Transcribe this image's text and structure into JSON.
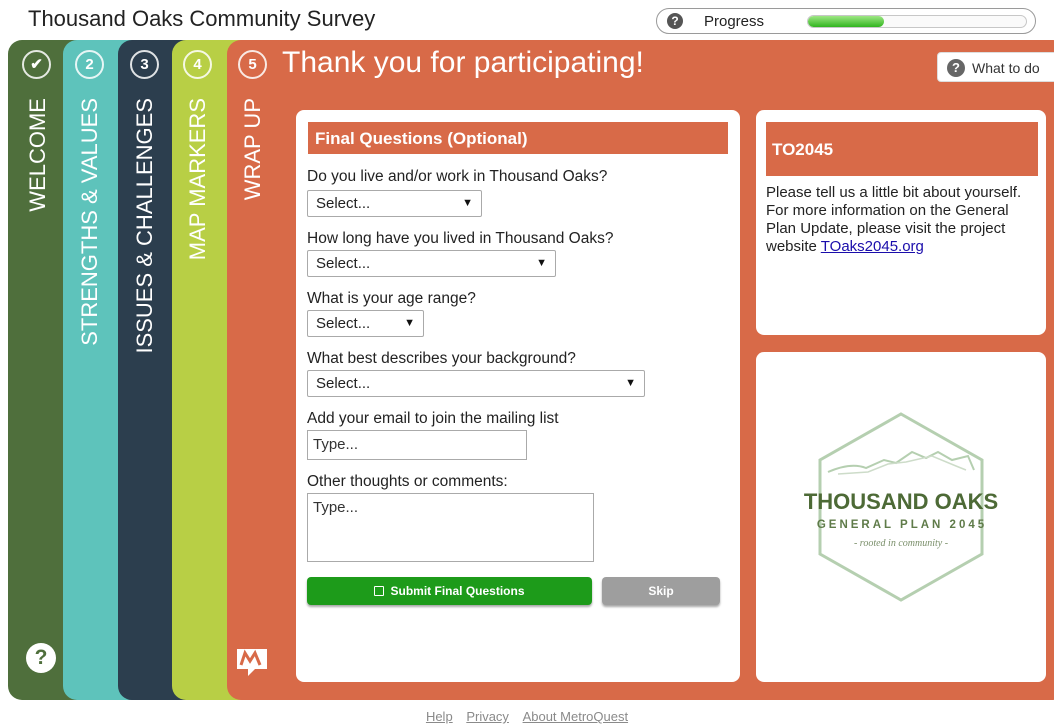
{
  "app": {
    "title": "Thousand Oaks Community Survey"
  },
  "progress": {
    "label": "Progress",
    "help_icon": "question-icon",
    "value": 0.35,
    "fill_color": "#31b51f"
  },
  "tabs": [
    {
      "number": "✔",
      "label": "WELCOME",
      "color": "#4f6f3c",
      "status": "complete"
    },
    {
      "number": "2",
      "label": "STRENGTHS & VALUES",
      "color": "#5ec3bb"
    },
    {
      "number": "3",
      "label": "ISSUES & CHALLENGES",
      "color": "#2c3e4e"
    },
    {
      "number": "4",
      "label": "MAP MARKERS",
      "color": "#b8cf45"
    },
    {
      "number": "5",
      "label": "WRAP UP",
      "color": "#d86a48",
      "active": true
    }
  ],
  "header": {
    "title": "Thank you for participating!",
    "what_to_do_label": "What to do"
  },
  "form": {
    "title": "Final Questions (Optional)",
    "questions": [
      {
        "label": "Do you live and/or work in Thousand Oaks?",
        "value": "Select..."
      },
      {
        "label": "How long have you lived in Thousand Oaks?",
        "value": "Select..."
      },
      {
        "label": "What is your age range?",
        "value": "Select..."
      },
      {
        "label": "What best describes your background?",
        "value": "Select..."
      }
    ],
    "email": {
      "label": "Add your email to join the mailing list",
      "placeholder": "Type..."
    },
    "comments": {
      "label": "Other thoughts or comments:",
      "placeholder": "Type..."
    },
    "submit_label": "Submit Final Questions",
    "skip_label": "Skip"
  },
  "info": {
    "title": "TO2045",
    "text": "Please tell us a little bit about yourself. For more information on the General Plan Update, please visit the project website",
    "link": "TOaks2045.org"
  },
  "logo": {
    "line1": "THOUSAND OAKS",
    "line2": "GENERAL PLAN 2045",
    "tagline": "- rooted in community -",
    "color": "#4d6a36"
  },
  "footer": {
    "links": [
      "Help",
      "Privacy",
      "About MetroQuest"
    ]
  },
  "colors": {
    "accent": "#d86a48",
    "submit": "#1d9b1a",
    "skip": "#9e9e9e"
  }
}
